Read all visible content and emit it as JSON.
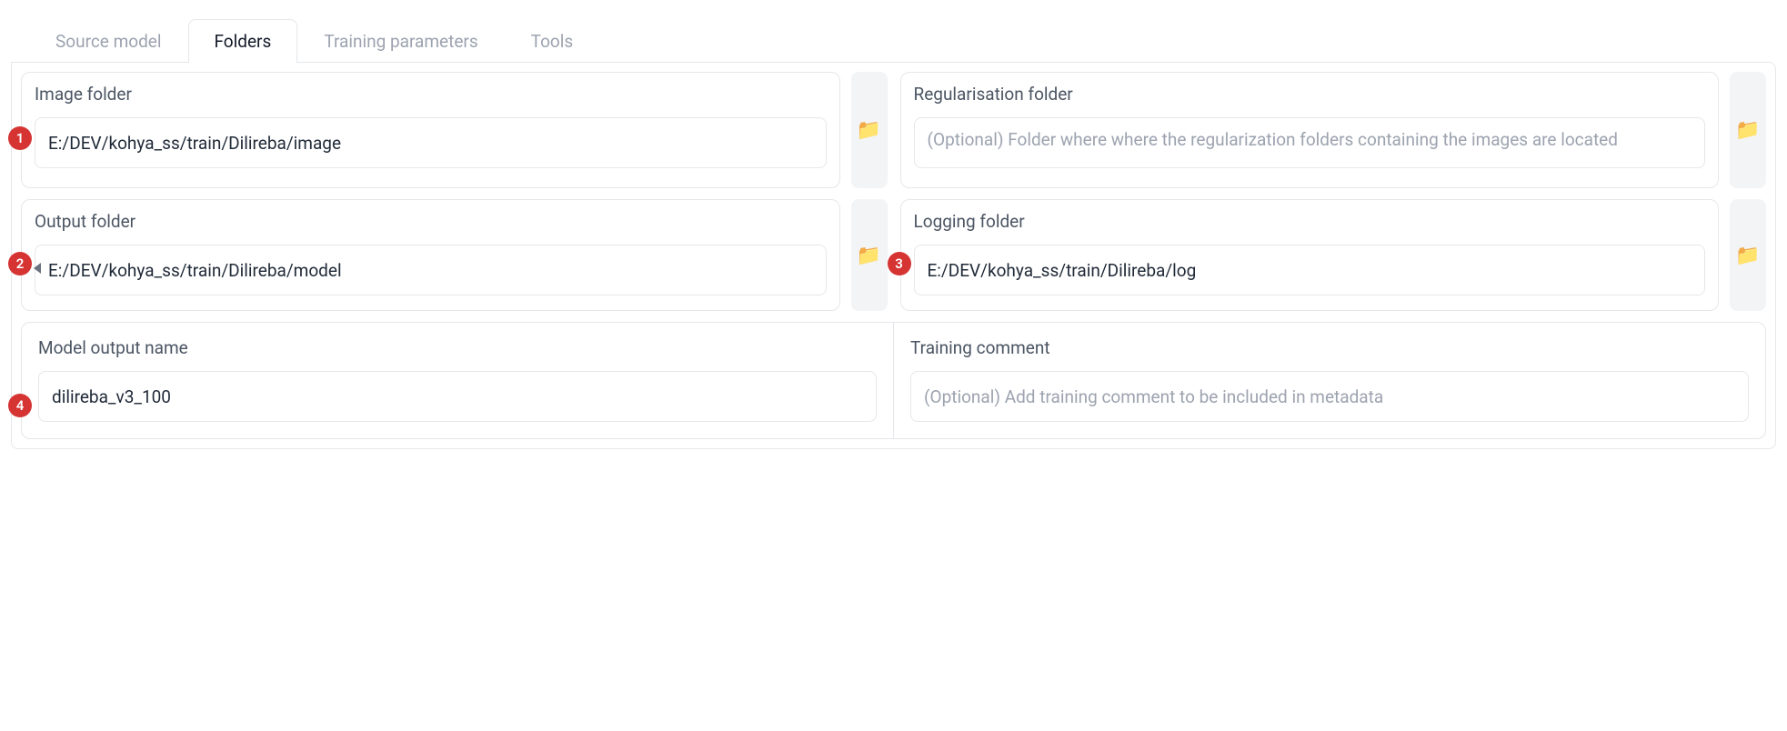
{
  "tabs": [
    {
      "label": "Source model",
      "active": false
    },
    {
      "label": "Folders",
      "active": true
    },
    {
      "label": "Training parameters",
      "active": false
    },
    {
      "label": "Tools",
      "active": false
    }
  ],
  "badges": {
    "b1": "1",
    "b2": "2",
    "b3": "3",
    "b4": "4"
  },
  "folder_icon": "📁",
  "fields": {
    "image_folder": {
      "label": "Image folder",
      "value": "E:/DEV/kohya_ss/train/Dilireba/image",
      "placeholder": ""
    },
    "regularisation_folder": {
      "label": "Regularisation folder",
      "value": "",
      "placeholder": "(Optional) Folder where where the regularization folders containing the images are located"
    },
    "output_folder": {
      "label": "Output folder",
      "value": "E:/DEV/kohya_ss/train/Dilireba/model",
      "placeholder": ""
    },
    "logging_folder": {
      "label": "Logging folder",
      "value": "E:/DEV/kohya_ss/train/Dilireba/log",
      "placeholder": ""
    },
    "model_output_name": {
      "label": "Model output name",
      "value": "dilireba_v3_100",
      "placeholder": ""
    },
    "training_comment": {
      "label": "Training comment",
      "value": "",
      "placeholder": "(Optional) Add training comment to be included in metadata"
    }
  }
}
